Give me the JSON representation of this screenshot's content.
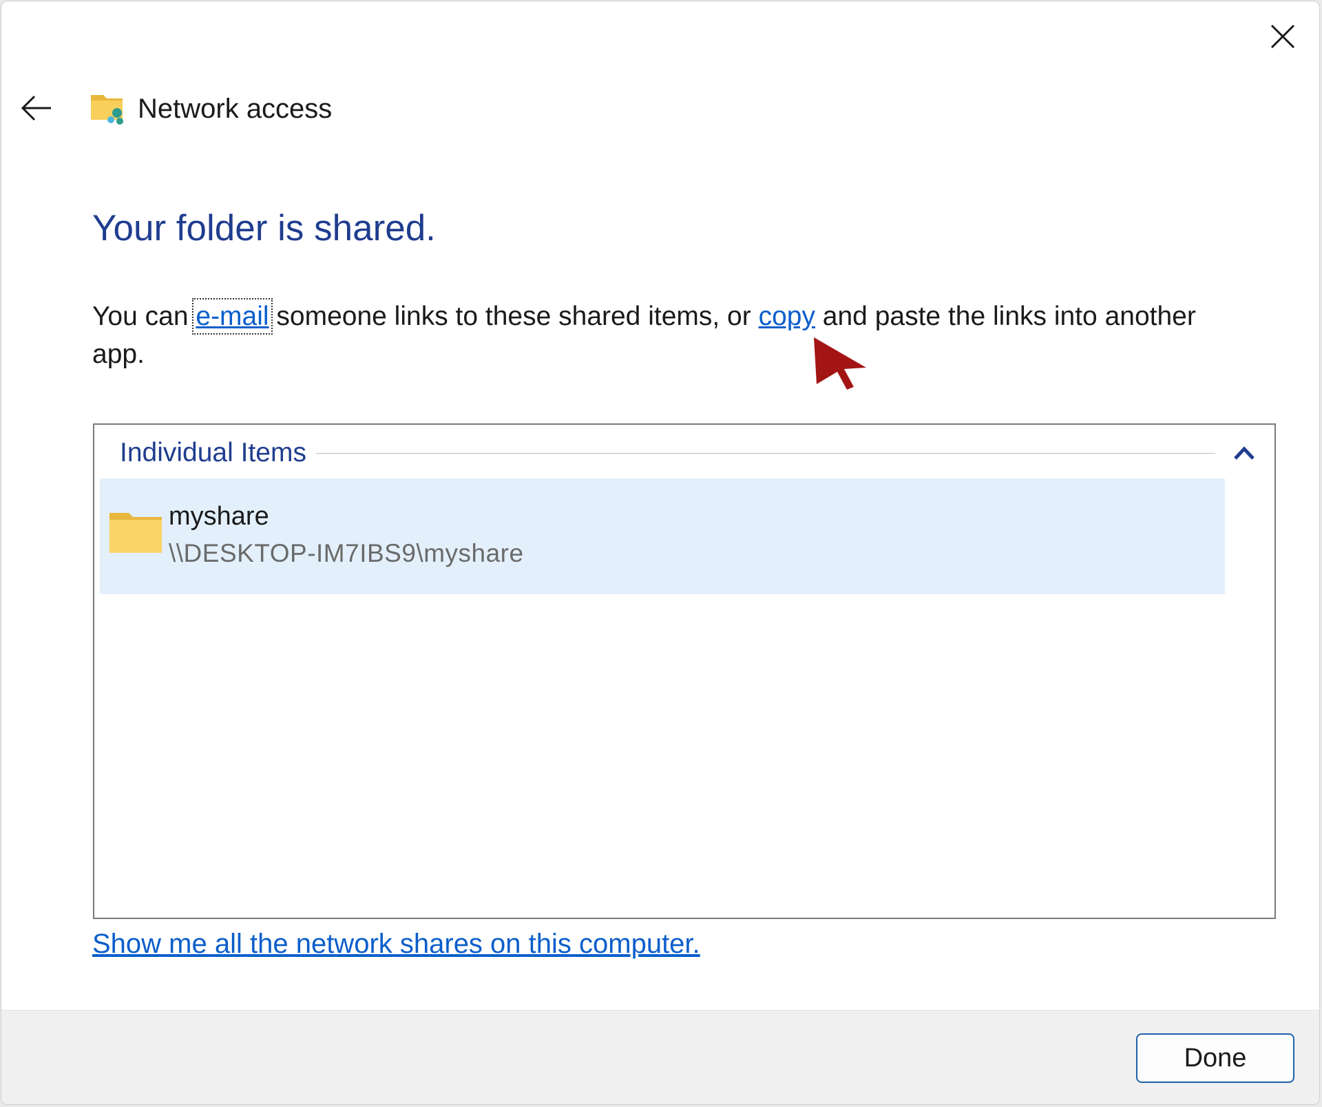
{
  "window": {
    "title": "Network access",
    "close_icon": "close-icon",
    "back_icon": "back-arrow-icon",
    "title_icon": "network-folder-icon"
  },
  "main": {
    "heading": "Your folder is shared.",
    "description": {
      "part1": "You can ",
      "email_link": "e-mail",
      "part2": " someone links to these shared items, or ",
      "copy_link": "copy",
      "part3": " and paste the links into another app."
    }
  },
  "items": {
    "group_label": "Individual Items",
    "collapse_icon": "chevron-up-icon",
    "rows": [
      {
        "name": "myshare",
        "path": "\\\\DESKTOP-IM7IBS9\\myshare",
        "icon": "folder-icon",
        "selected": true
      }
    ]
  },
  "show_all_link": "Show me all the network shares on this computer.",
  "footer": {
    "done_label": "Done"
  },
  "colors": {
    "heading": "#1f3d8f",
    "link": "#0b5ecb",
    "selected_row": "#e3f0fb",
    "button_border": "#1f5fa8",
    "cursor": "#a31515"
  }
}
